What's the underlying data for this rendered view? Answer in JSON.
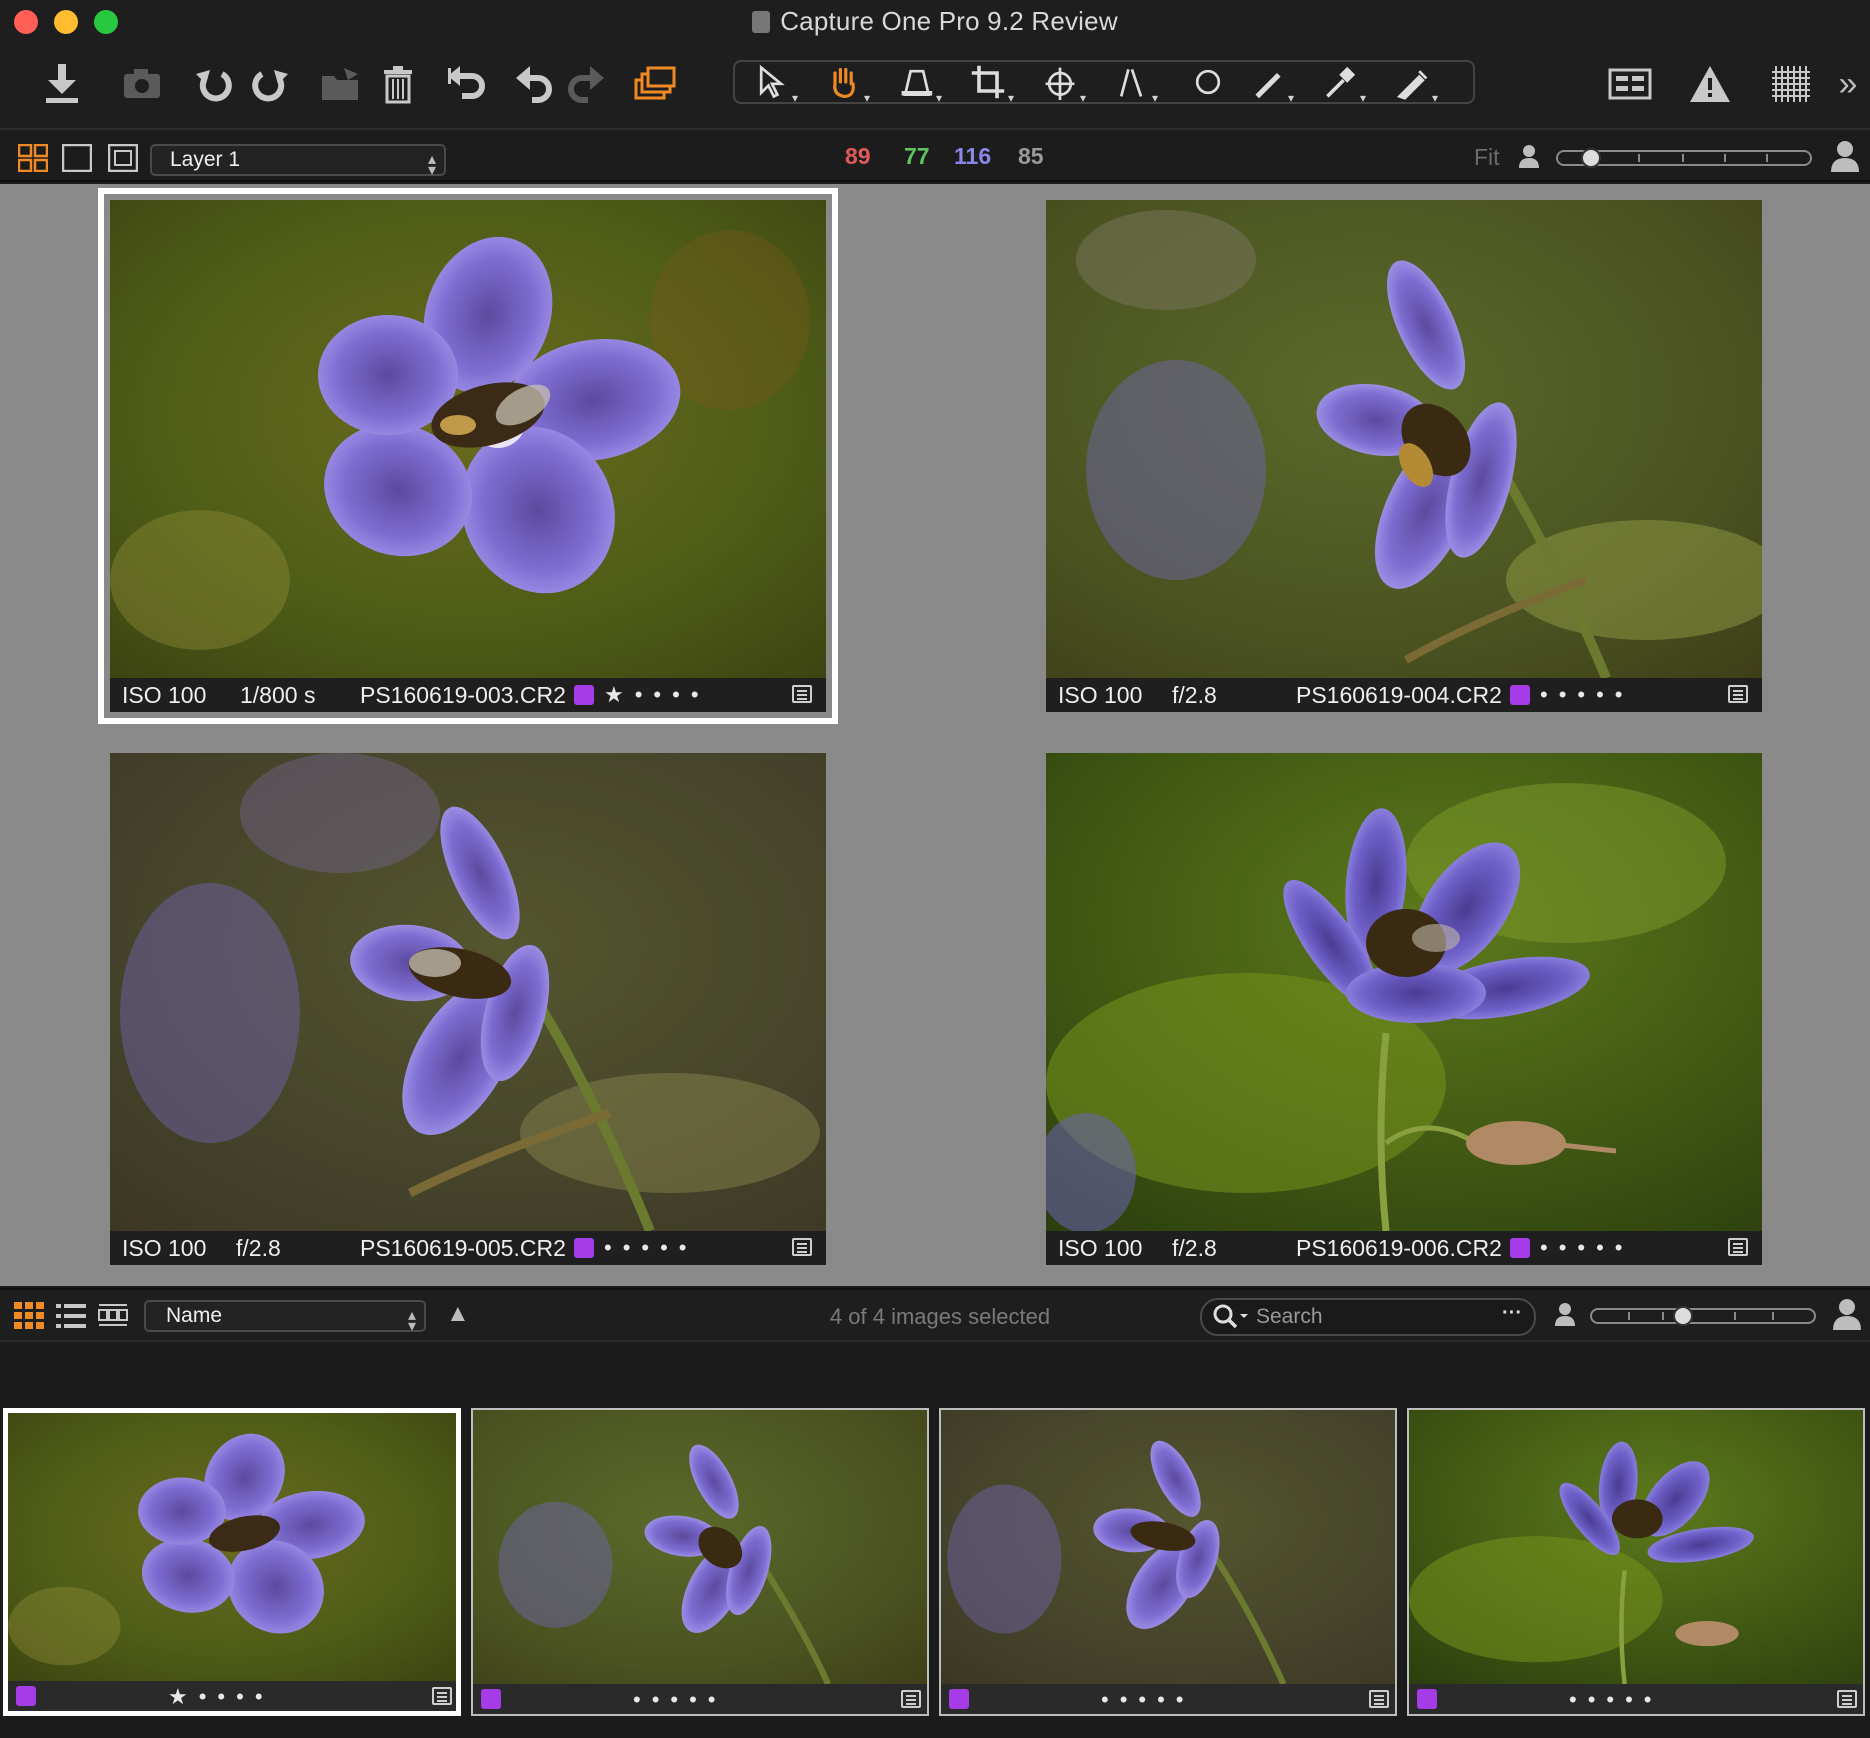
{
  "window": {
    "title": "Capture One Pro 9.2 Review",
    "traffic_lights": [
      "#fe5f57",
      "#febc2e",
      "#28c840"
    ]
  },
  "toolbar": {
    "icons": [
      "import-icon",
      "camera-capture-icon",
      "rotate-left-icon",
      "rotate-right-icon",
      "move-to-folder-icon",
      "trash-icon",
      "reset-adjustments-icon",
      "undo-icon",
      "redo-icon",
      "variants-icon"
    ],
    "cursor_tools": [
      "select-tool",
      "pan-tool",
      "keystone-tool",
      "crop-tool",
      "rotate-tool",
      "straighten-tool",
      "spot-removal-tool",
      "draw-mask-tool",
      "color-picker-tool",
      "annotate-tool"
    ],
    "right_icons": [
      "viewer-layout-icon",
      "exposure-warning-icon",
      "grid-icon",
      "more-icon"
    ]
  },
  "viewer_bar": {
    "layer": "Layer 1",
    "rgb": {
      "r": "89",
      "g": "77",
      "b": "116",
      "l": "85"
    },
    "rgb_colors": {
      "r": "#e05a5a",
      "g": "#5fc45f",
      "b": "#8c86e8",
      "l": "#9a9a9a"
    },
    "zoom_label": "Fit",
    "zoom_level": 0.1
  },
  "viewer": {
    "images": [
      {
        "iso": "ISO 100",
        "exposure": "1/800 s",
        "filename": "PS160619-003.CR2",
        "color_tag": "#a63ce8",
        "rating": 1,
        "selected": true
      },
      {
        "iso": "ISO 100",
        "exposure": "f/2.8",
        "filename": "PS160619-004.CR2",
        "color_tag": "#a63ce8",
        "rating": 0,
        "selected": false
      },
      {
        "iso": "ISO 100",
        "exposure": "f/2.8",
        "filename": "PS160619-005.CR2",
        "color_tag": "#a63ce8",
        "rating": 0,
        "selected": false
      },
      {
        "iso": "ISO 100",
        "exposure": "f/2.8",
        "filename": "PS160619-006.CR2",
        "color_tag": "#a63ce8",
        "rating": 0,
        "selected": false
      }
    ]
  },
  "browser_bar": {
    "sort_by": "Name",
    "selection_status": "4 of 4 images selected",
    "search_placeholder": "Search",
    "thumb_size": 0.4
  },
  "browser": {
    "thumbnails": [
      {
        "rating": 1,
        "color_tag": "#a63ce8",
        "selected": true
      },
      {
        "rating": 0,
        "color_tag": "#a63ce8",
        "selected": false
      },
      {
        "rating": 0,
        "color_tag": "#a63ce8",
        "selected": false
      },
      {
        "rating": 0,
        "color_tag": "#a63ce8",
        "selected": false
      }
    ]
  }
}
